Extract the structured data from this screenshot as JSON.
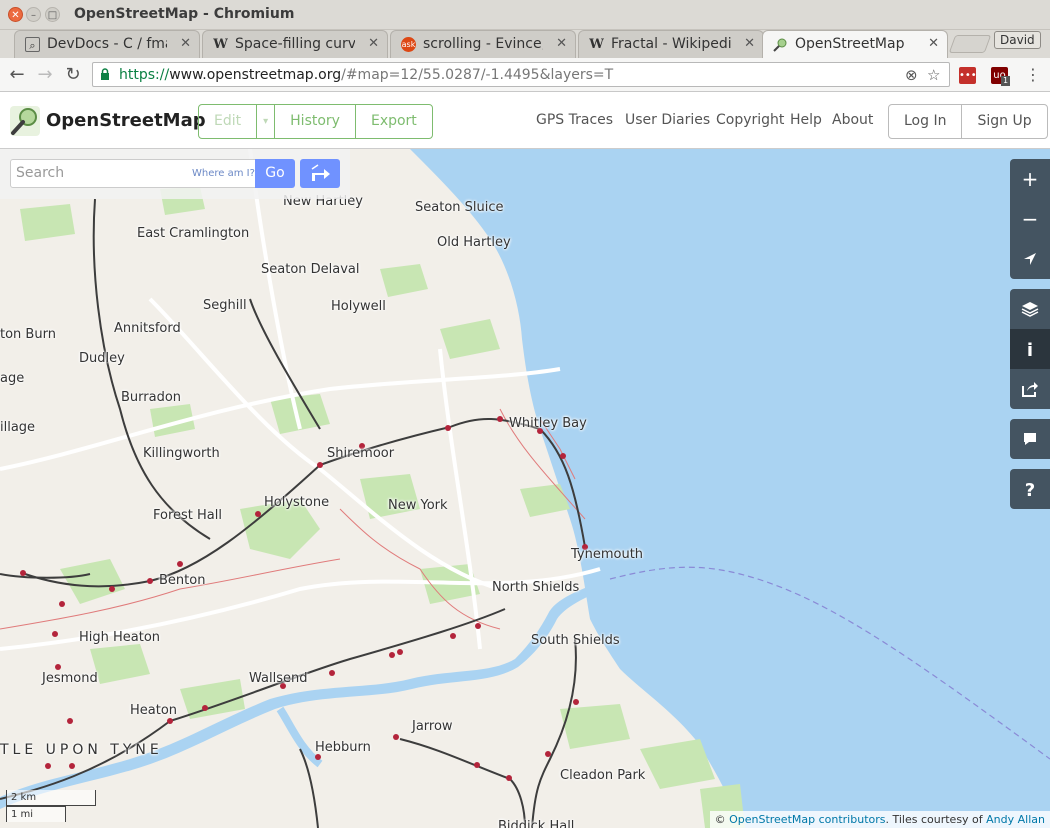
{
  "window": {
    "title": "OpenStreetMap - Chromium",
    "profile_name": "David"
  },
  "tabs": [
    {
      "label": "DevDocs - C / fmax",
      "icon": "search-icon",
      "active": false
    },
    {
      "label": "Space-filling curve",
      "icon": "wikipedia-icon",
      "active": false
    },
    {
      "label": "scrolling - Evince, r",
      "icon": "askubuntu-icon",
      "active": false
    },
    {
      "label": "Fractal - Wikipedia",
      "icon": "wikipedia-icon",
      "active": false
    },
    {
      "label": "OpenStreetMap",
      "icon": "osm-icon",
      "active": true
    }
  ],
  "toolbar": {
    "url_scheme": "https://",
    "url_host": "www.openstreetmap.org",
    "url_rest": "/#map=12/55.0287/-1.4495&layers=T",
    "extension_badge": "1"
  },
  "header": {
    "brand": "OpenStreetMap",
    "edit_label": "Edit",
    "history_label": "History",
    "export_label": "Export",
    "nav": [
      "GPS Traces",
      "User Diaries",
      "Copyright",
      "Help",
      "About"
    ],
    "login_label": "Log In",
    "signup_label": "Sign Up"
  },
  "search": {
    "placeholder": "Search",
    "where_am_i": "Where am I?",
    "go_label": "Go"
  },
  "map": {
    "zoom": 12,
    "lat": 55.0287,
    "lon": -1.4495,
    "layer": "Transport",
    "water_color": "#aad3f2",
    "land_color": "#f2efe9",
    "park_color": "#c8e6b3",
    "rail_color": "#3d3d3d",
    "station_color": "#b3243b",
    "places": [
      "New Hartley",
      "Seaton Sluice",
      "Old Hartley",
      "East Cramlington",
      "Seaton Delaval",
      "Seghill",
      "Holywell",
      "Annitsford",
      "ton Burn",
      "Dudley",
      "age",
      "Burradon",
      "illage",
      "Whitley Bay",
      "Killingworth",
      "Shiremoor",
      "Forest Hall",
      "Holystone",
      "New York",
      "Tynemouth",
      "Benton",
      "North Shields",
      "High Heaton",
      "South Shields",
      "Jesmond",
      "Wallsend",
      "Heaton",
      "Jarrow",
      "TLE UPON TYNE",
      "Hebburn",
      "Cleadon Park",
      "Biddick Hall"
    ]
  },
  "scale": {
    "km": "2 km",
    "mi": "1 mi"
  },
  "attribution": {
    "prefix": "© ",
    "contributors": "OpenStreetMap contributors",
    "middle": ". Tiles courtesy of ",
    "author": "Andy Allan"
  }
}
